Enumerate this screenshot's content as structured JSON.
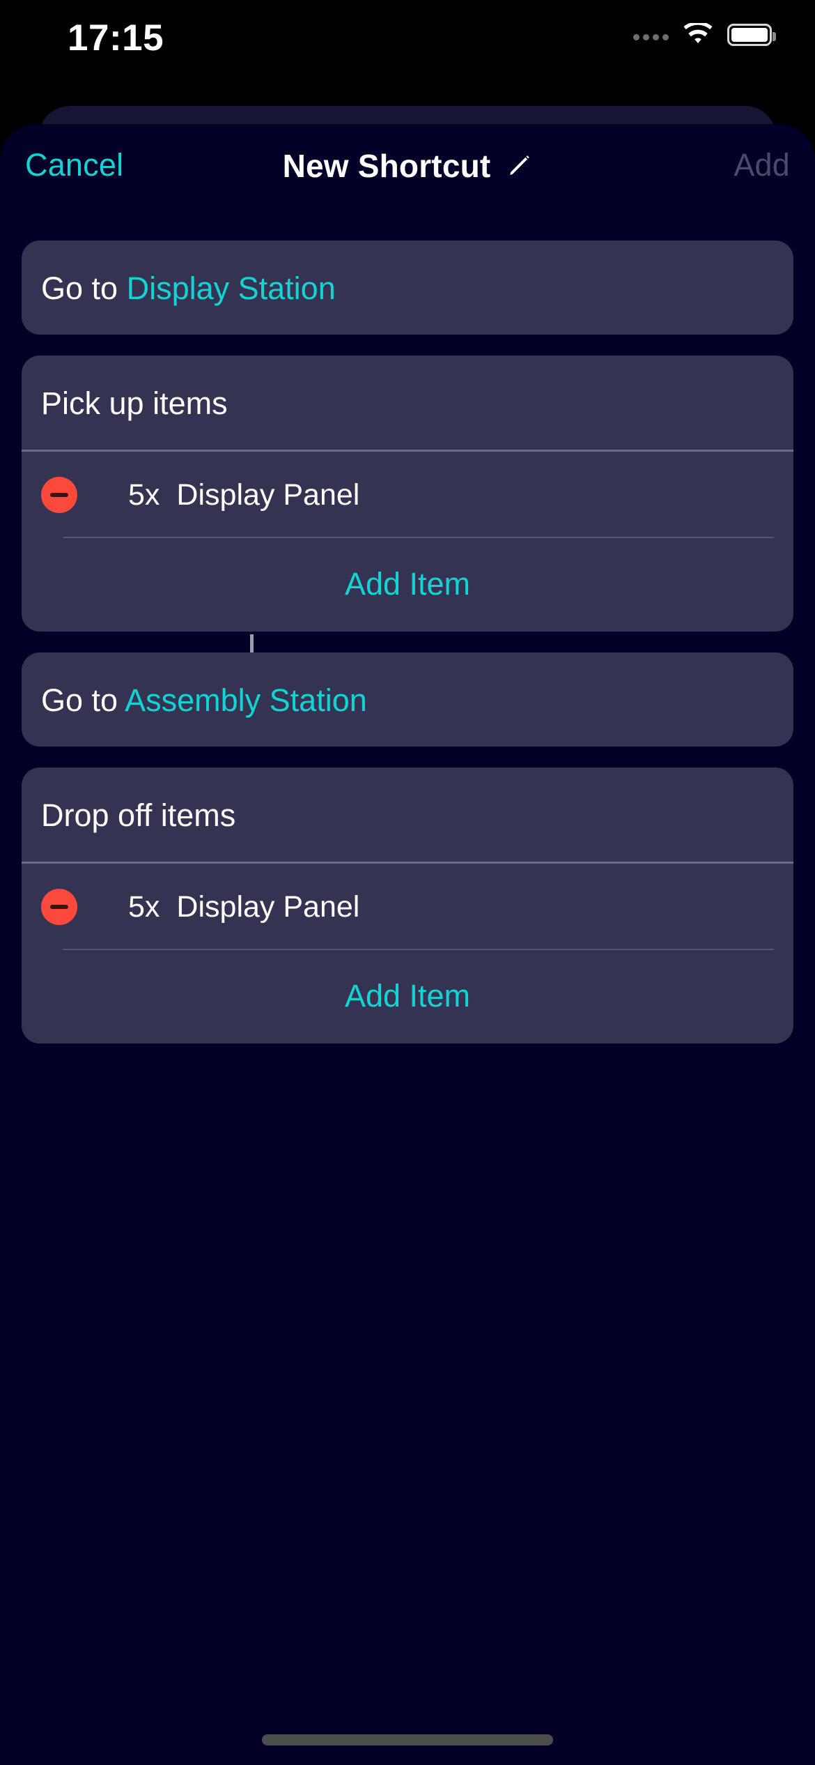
{
  "status_bar": {
    "time": "17:15",
    "signal_icon": "signal-dots-icon",
    "wifi_icon": "wifi-icon",
    "battery_icon": "battery-full-icon"
  },
  "navbar": {
    "cancel_label": "Cancel",
    "title": "New Shortcut",
    "edit_icon": "pencil-icon",
    "add_label": "Add",
    "add_enabled": false
  },
  "colors": {
    "accent": "#12d4d4",
    "card_background": "#353352",
    "sheet_background": "#030027",
    "destructive": "#fb4a3c",
    "disabled_text": "#4a4a6b",
    "connector": "#9a9ab0"
  },
  "actions": [
    {
      "type": "goto",
      "prefix": "Go to ",
      "destination": "Display Station"
    },
    {
      "type": "pickup",
      "title": "Pick up items",
      "items": [
        {
          "remove_icon": "minus-circle-icon",
          "quantity": "5x",
          "name": "Display Panel"
        }
      ],
      "add_item_label": "Add Item"
    },
    {
      "type": "goto",
      "prefix": "Go to ",
      "destination": "Assembly Station"
    },
    {
      "type": "dropoff",
      "title": "Drop off items",
      "items": [
        {
          "remove_icon": "minus-circle-icon",
          "quantity": "5x",
          "name": "Display Panel"
        }
      ],
      "add_item_label": "Add Item"
    }
  ],
  "home_indicator": "home-indicator"
}
